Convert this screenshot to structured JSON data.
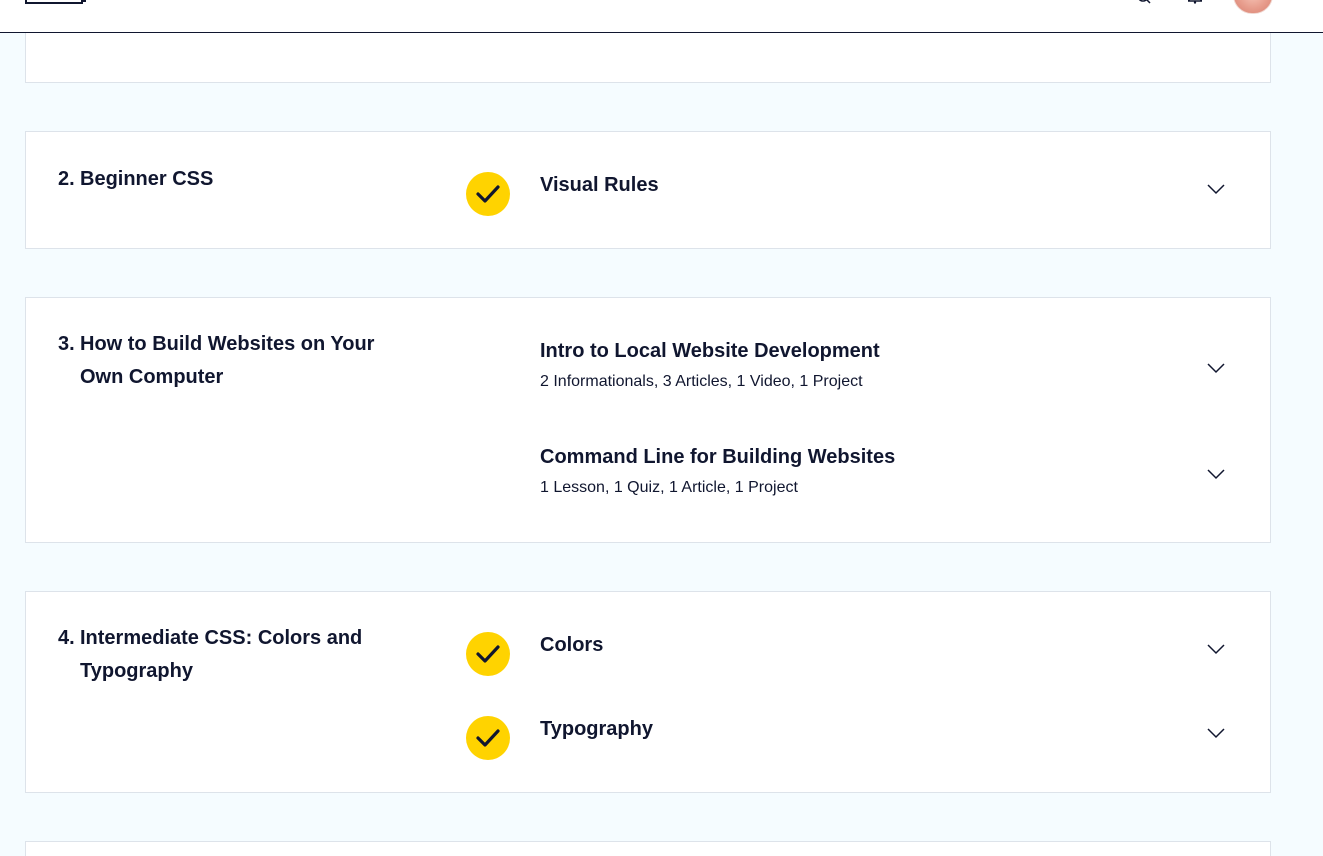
{
  "modules": [
    {
      "number": "2.",
      "title": "Beginner CSS",
      "lessons": [
        {
          "title": "Visual Rules",
          "completed": true
        }
      ]
    },
    {
      "number": "3.",
      "title": "How to Build Websites on Your Own Computer",
      "lessons": [
        {
          "title": "Intro to Local Website Development",
          "meta": "2 Informationals, 3 Articles, 1 Video, 1 Project",
          "completed": false
        },
        {
          "title": "Command Line for Building Websites",
          "meta": "1 Lesson, 1 Quiz, 1 Article, 1 Project",
          "completed": false
        }
      ]
    },
    {
      "number": "4.",
      "title": "Intermediate CSS: Colors and Typography",
      "lessons": [
        {
          "title": "Colors",
          "completed": true
        },
        {
          "title": "Typography",
          "completed": true
        }
      ]
    }
  ],
  "icons": {
    "check": "checkmark-icon",
    "expand": "chevron-down-icon",
    "search": "search-icon",
    "notifications": "bell-icon"
  },
  "colors": {
    "page_background": "#f5fcff",
    "card_background": "#ffffff",
    "check_badge": "#ffd300",
    "text": "#10162f"
  }
}
